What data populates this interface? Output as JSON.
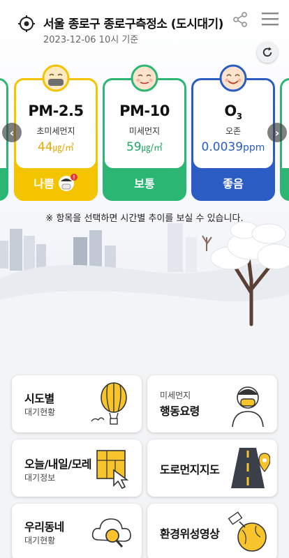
{
  "header": {
    "station": "서울 종로구 종로구측정소 (도시대기)",
    "timestamp": "2023-12-06 10시 기준"
  },
  "icons": {
    "location": "location-target-icon",
    "share": "share-icon",
    "menu": "hamburger-menu-icon",
    "refresh": "refresh-icon",
    "prev": "chevron-left-icon",
    "next": "chevron-right-icon"
  },
  "cards": [
    {
      "name": "PM-2.5",
      "sub": "초미세먼지",
      "value": "44",
      "unit": "㎍/㎥",
      "status": "나쁨",
      "color": "#f5c400",
      "value_color": "#e5a800",
      "face": "masked-face-icon"
    },
    {
      "name": "PM-10",
      "sub": "미세먼지",
      "value": "59",
      "unit": "㎍/㎥",
      "status": "보통",
      "color": "#2bb673",
      "value_color": "#1ea765",
      "face": "neutral-face-icon"
    },
    {
      "name": "O",
      "name_sub": "3",
      "sub": "오존",
      "value": "0.0039",
      "unit": "ppm",
      "status": "좋음",
      "color": "#2a5cc4",
      "value_color": "#2a5cc4",
      "face": "smile-face-icon"
    }
  ],
  "hint": "※ 항목을 선택하면 시간별 추이를 보실 수 있습니다.",
  "menu": [
    {
      "line1": "시도별",
      "line2": "대기현황",
      "icon": "hot-air-balloon-icon"
    },
    {
      "line1": "미세먼지",
      "line2": "행동요령",
      "icon": "masked-person-icon"
    },
    {
      "line1": "오늘/내일/모레",
      "line2": "대기정보",
      "icon": "map-pointer-icon"
    },
    {
      "line1": "도로먼지지도",
      "line2": "",
      "icon": "road-map-icon"
    },
    {
      "line1": "우리동네",
      "line2": "대기현황",
      "icon": "cloud-search-icon"
    },
    {
      "line1": "환경위성영상",
      "line2": "",
      "icon": "satellite-icon"
    }
  ]
}
